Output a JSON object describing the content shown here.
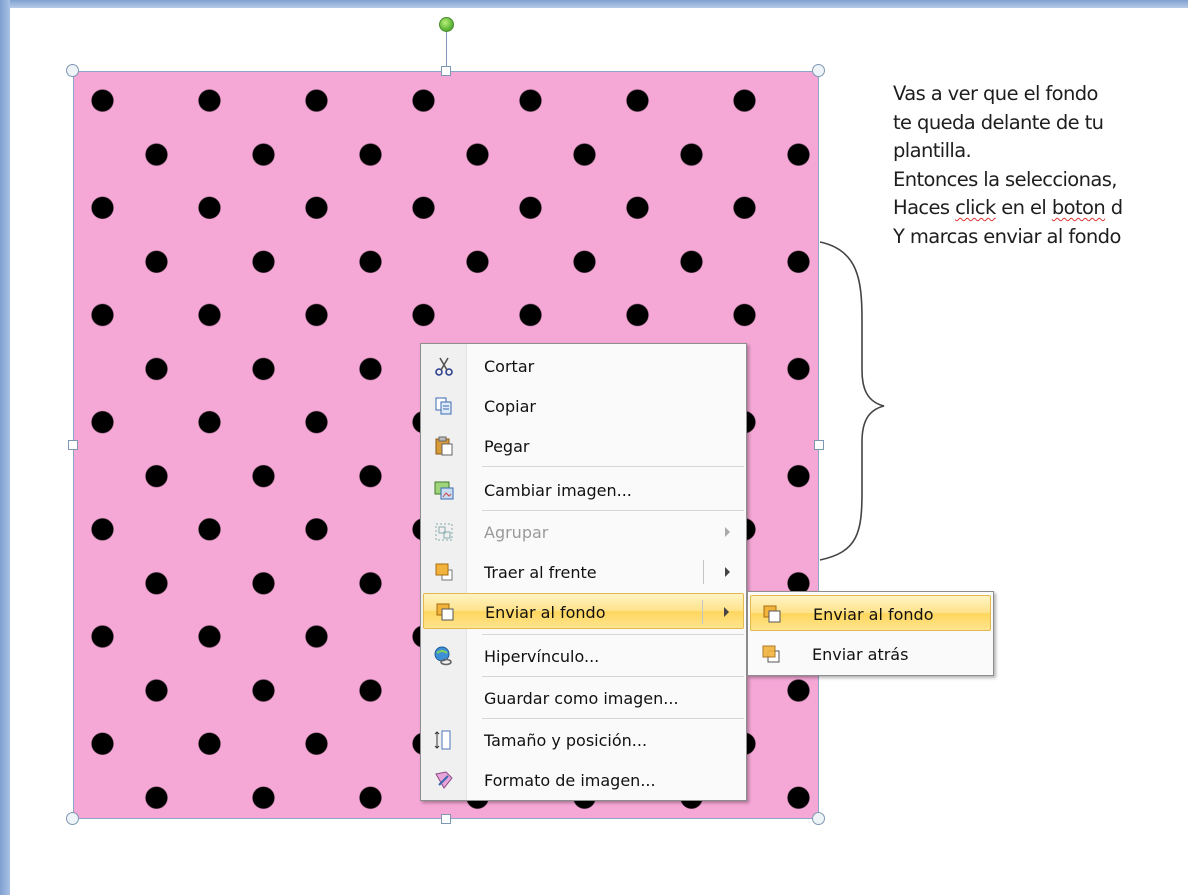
{
  "note": {
    "lines": [
      "Vas a ver que el fondo",
      "te queda delante de tu",
      "plantilla.",
      "Entonces la seleccionas,"
    ],
    "line5_pre": "Haces ",
    "line5_click": "click",
    "line5_mid": " en el ",
    "line5_boton": "boton",
    "line5_post": " d",
    "line6": "Y marcas enviar al fondo"
  },
  "context_menu": {
    "items": [
      {
        "label": "Cortar",
        "icon": "scissors-icon"
      },
      {
        "label": "Copiar",
        "icon": "copy-icon"
      },
      {
        "label": "Pegar",
        "icon": "paste-icon"
      },
      {
        "label": "Cambiar imagen...",
        "icon": "change-picture-icon"
      },
      {
        "label": "Agrupar",
        "icon": "group-icon",
        "disabled": true
      },
      {
        "label": "Traer al frente",
        "icon": "bring-to-front-icon"
      },
      {
        "label": "Enviar al fondo",
        "icon": "send-to-back-icon",
        "highlighted": true
      },
      {
        "label": "Hipervínculo...",
        "icon": "hyperlink-icon"
      },
      {
        "label": "Guardar como imagen...",
        "icon": ""
      },
      {
        "label": "Tamaño y posición...",
        "icon": "size-position-icon"
      },
      {
        "label": "Formato de imagen...",
        "icon": "format-picture-icon"
      }
    ]
  },
  "submenu": {
    "items": [
      {
        "label": "Enviar al fondo",
        "icon": "send-to-back-icon",
        "highlighted": true
      },
      {
        "label": "Enviar atrás",
        "icon": "send-backward-icon"
      }
    ]
  },
  "colors": {
    "picture_background": "#f5a7d6",
    "dots": "#000000",
    "highlight": "#ffe38a"
  }
}
